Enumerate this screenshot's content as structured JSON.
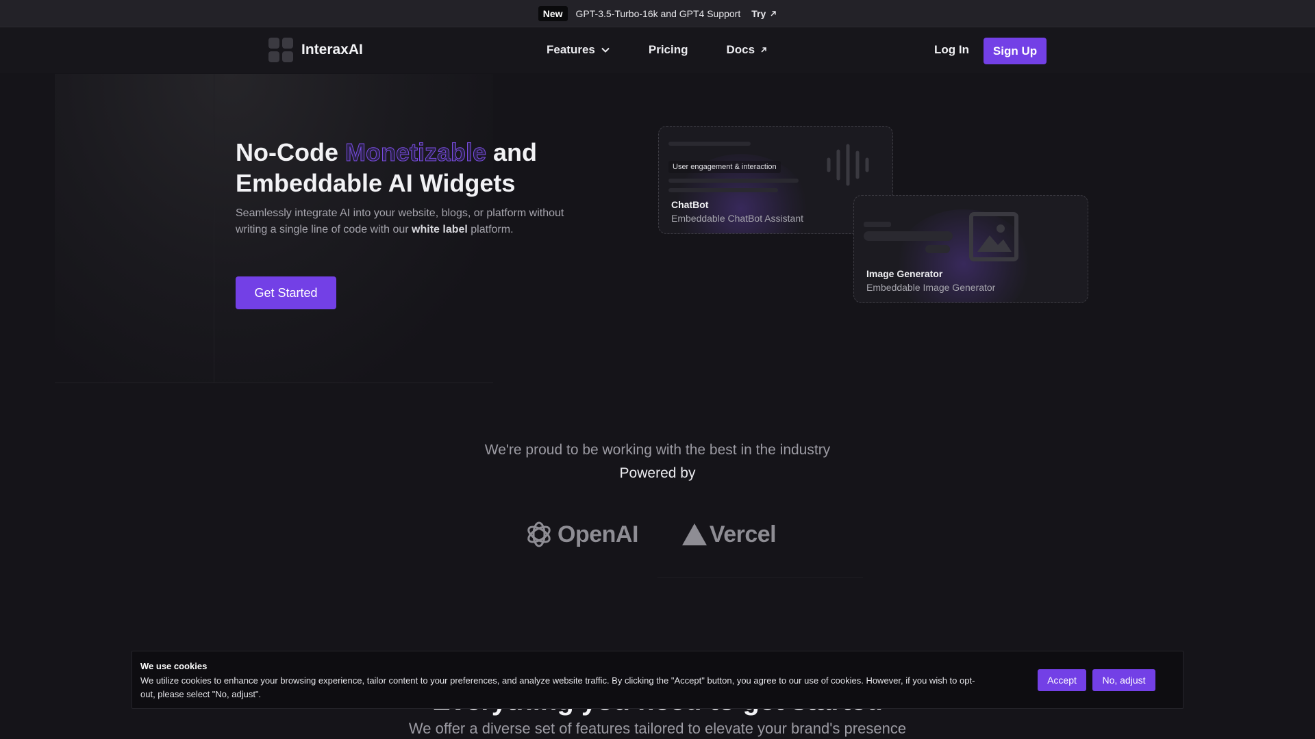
{
  "announcement": {
    "badge": "New",
    "text": "GPT-3.5-Turbo-16k and GPT4 Support",
    "link_label": "Try",
    "link_icon": "arrow-up-right-icon"
  },
  "nav": {
    "brand": "InteraxAI",
    "links": [
      {
        "label": "Features",
        "icon": "chevron-down-icon"
      },
      {
        "label": "Pricing"
      },
      {
        "label": "Docs",
        "icon": "arrow-up-right-icon"
      }
    ],
    "login_label": "Log In",
    "signup_label": "Sign Up"
  },
  "hero": {
    "title_start": "No-Code ",
    "title_accent": "Monetizable",
    "title_end": " and Embeddable AI Widgets",
    "desc_start": "Seamlessly integrate AI into your website, blogs, or platform without writing a single line of code with our ",
    "desc_bold": "white label",
    "desc_end": " platform.",
    "cta_label": "Get Started"
  },
  "widgets": [
    {
      "title": "ChatBot",
      "subtitle": "Embeddable ChatBot Assistant",
      "chip": "User engagement & interaction",
      "icon": "waveform-icon"
    },
    {
      "title": "Image Generator",
      "subtitle": "Embeddable Image Generator",
      "icon": "image-icon"
    }
  ],
  "partners": {
    "heading": "We're proud to be working with the best in the industry",
    "subheading": "Powered by",
    "logos": [
      {
        "name": "OpenAI",
        "icon": "openai-logo-icon"
      },
      {
        "name": "Vercel",
        "icon": "vercel-triangle-icon"
      }
    ]
  },
  "features": {
    "heading": "Everything you need to get started",
    "subtitle": "We offer a diverse set of features tailored to elevate your brand's presence"
  },
  "cookie_banner": {
    "title": "We use cookies",
    "body": "We utilize cookies to enhance your browsing experience, tailor content to your preferences, and analyze website traffic. By clicking the \"Accept\" button, you agree to our use of cookies. However, if you wish to opt-out, please select \"No, adjust\".",
    "accept_label": "Accept",
    "adjust_label": "No, adjust"
  },
  "colors": {
    "background": "#151419",
    "accent": "#7340e6",
    "text_muted": "#a6a5ad"
  }
}
